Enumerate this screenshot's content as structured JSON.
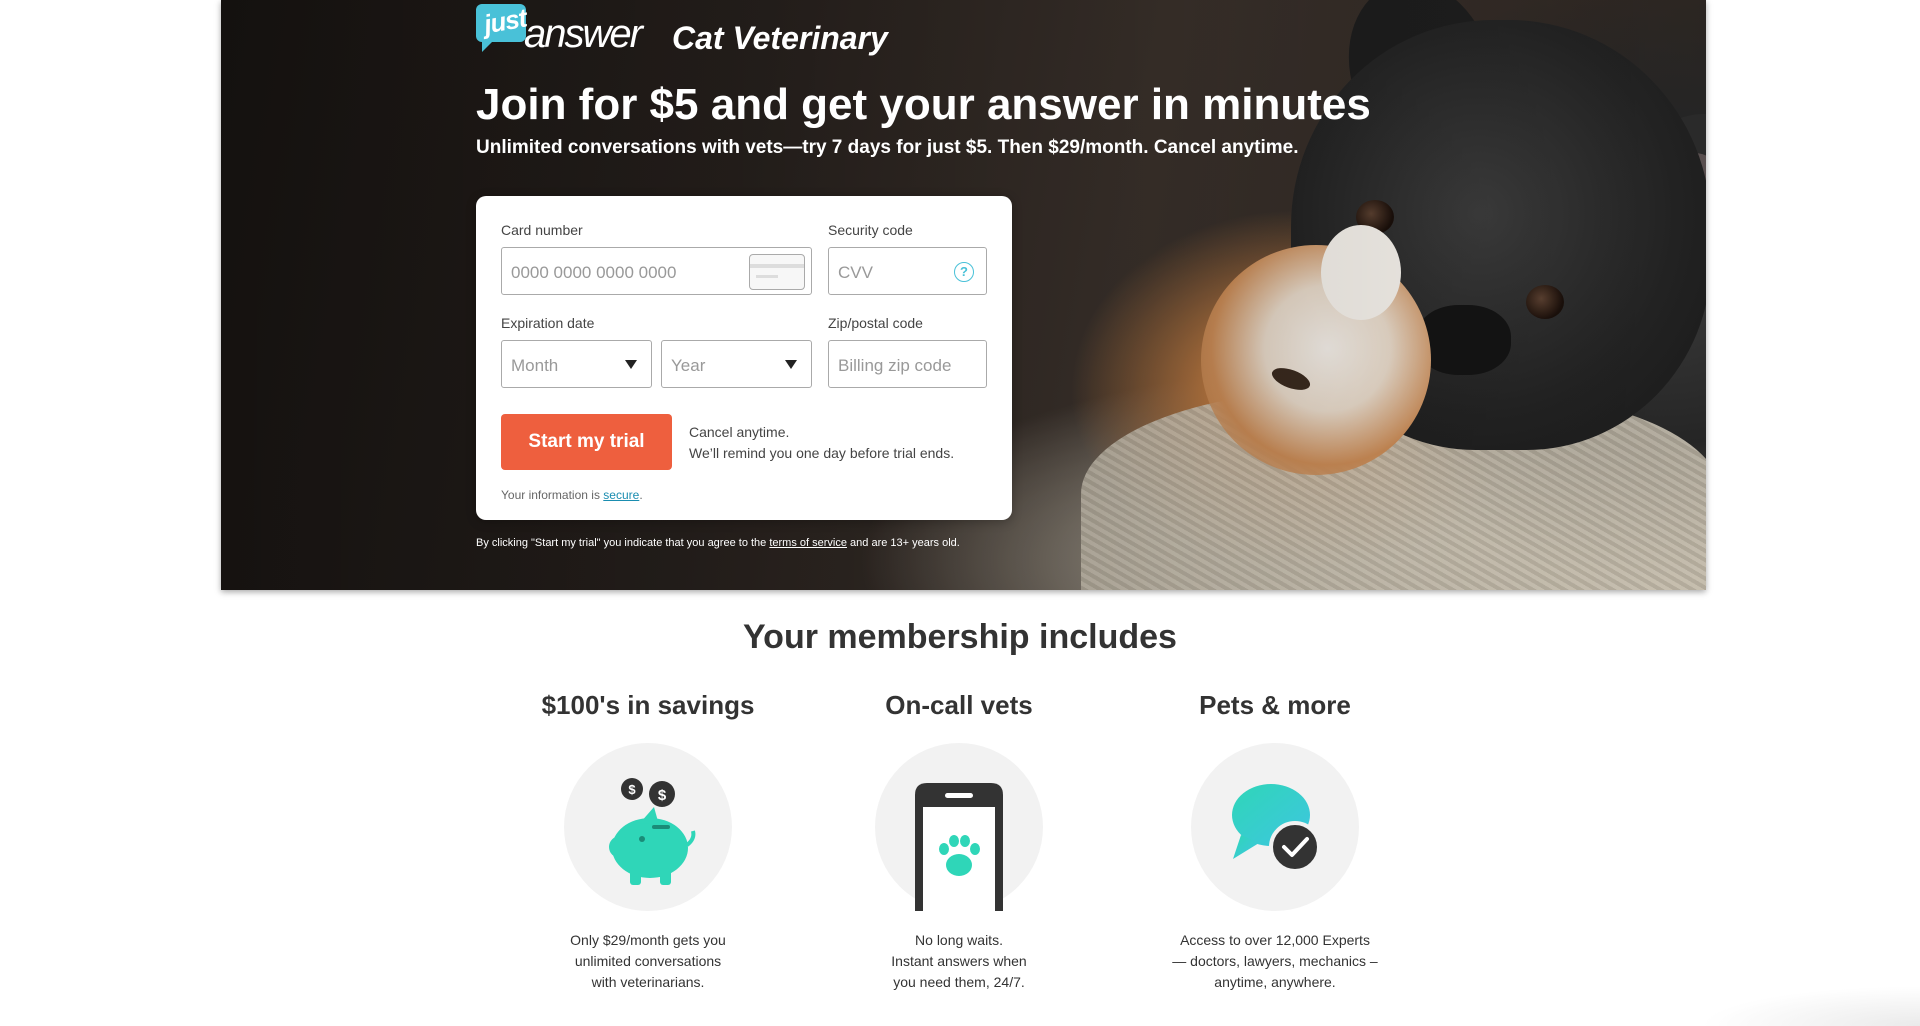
{
  "logo": {
    "just": "just",
    "answer": "answer",
    "category": "Cat Veterinary"
  },
  "hero": {
    "headline": "Join for $5 and get your answer in minutes",
    "subheadline": "Unlimited conversations with vets—try 7 days for just $5. Then $29/month. Cancel anytime."
  },
  "form": {
    "card_number_label": "Card number",
    "card_number_placeholder": "0000 0000 0000 0000",
    "security_code_label": "Security code",
    "security_code_placeholder": "CVV",
    "help_glyph": "?",
    "expiration_label": "Expiration date",
    "month_placeholder": "Month",
    "year_placeholder": "Year",
    "zip_label": "Zip/postal code",
    "zip_placeholder": "Billing zip code",
    "submit_label": "Start my trial",
    "cancel_line1": "Cancel anytime.",
    "cancel_line2": "We’ll remind you one day before trial ends.",
    "secure_prefix": "Your information is ",
    "secure_link": "secure",
    "secure_suffix": "."
  },
  "terms": {
    "prefix": "By clicking \"Start my trial\" you indicate that you agree to the ",
    "link": "terms of service",
    "suffix": " and are 13+ years old."
  },
  "membership": {
    "title": "Your membership includes",
    "features": [
      {
        "title": "$100's in savings",
        "icon": "piggy-bank-icon",
        "desc": [
          "Only $29/month gets you",
          "unlimited conversations",
          "with veterinarians."
        ]
      },
      {
        "title": "On-call vets",
        "icon": "phone-paw-icon",
        "desc": [
          "No long waits.",
          "Instant answers when",
          "you need them, 24/7."
        ]
      },
      {
        "title": "Pets & more",
        "icon": "chat-check-icon",
        "desc": [
          "Access to over 12,000 Experts",
          "— doctors, lawyers, mechanics –",
          "anytime, anywhere."
        ]
      }
    ]
  },
  "colors": {
    "accent": "#ee5f3e",
    "brand": "#49c1d8",
    "teal": "#2fd6b8",
    "dark": "#333333"
  }
}
